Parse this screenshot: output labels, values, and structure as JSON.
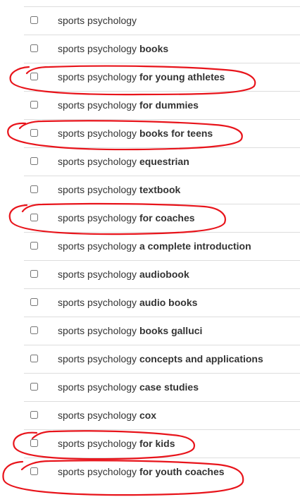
{
  "search_terms": {
    "items": [
      {
        "stem": "sports psychology",
        "suffix": "",
        "checked": false
      },
      {
        "stem": "sports psychology",
        "suffix": "books",
        "checked": false
      },
      {
        "stem": "sports psychology",
        "suffix": "for young athletes",
        "checked": false
      },
      {
        "stem": "sports psychology",
        "suffix": "for dummies",
        "checked": false
      },
      {
        "stem": "sports psychology",
        "suffix": "books for teens",
        "checked": false
      },
      {
        "stem": "sports psychology",
        "suffix": "equestrian",
        "checked": false
      },
      {
        "stem": "sports psychology",
        "suffix": "textbook",
        "checked": false
      },
      {
        "stem": "sports psychology",
        "suffix": "for coaches",
        "checked": false
      },
      {
        "stem": "sports psychology",
        "suffix": "a complete introduction",
        "checked": false
      },
      {
        "stem": "sports psychology",
        "suffix": "audiobook",
        "checked": false
      },
      {
        "stem": "sports psychology",
        "suffix": "audio books",
        "checked": false
      },
      {
        "stem": "sports psychology",
        "suffix": "books galluci",
        "checked": false
      },
      {
        "stem": "sports psychology",
        "suffix": "concepts and applications",
        "checked": false
      },
      {
        "stem": "sports psychology",
        "suffix": "case studies",
        "checked": false
      },
      {
        "stem": "sports psychology",
        "suffix": "cox",
        "checked": false
      },
      {
        "stem": "sports psychology",
        "suffix": "for kids",
        "checked": false
      },
      {
        "stem": "sports psychology",
        "suffix": "for youth coaches",
        "checked": false
      }
    ]
  },
  "annotations": {
    "color": "#e8141b",
    "circled_items": [
      "for young athletes",
      "books for teens",
      "for coaches",
      "for kids",
      "for youth coaches"
    ]
  }
}
